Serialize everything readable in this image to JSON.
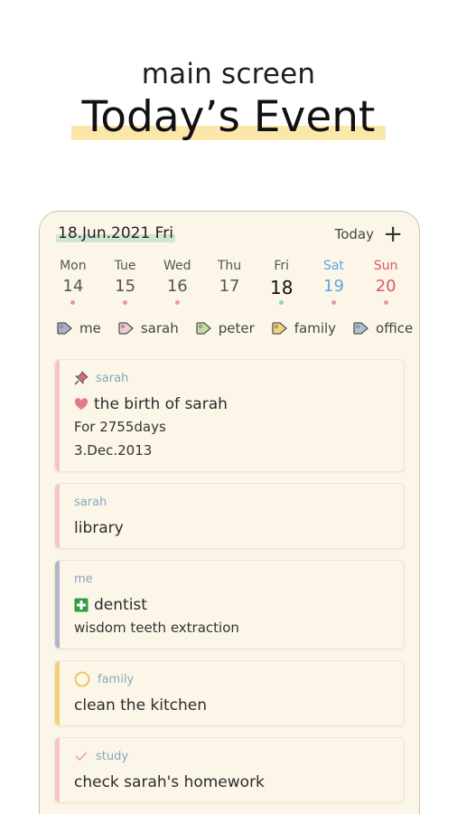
{
  "promo": {
    "subtitle": "main screen",
    "title": "Today’s Event"
  },
  "colors": {
    "highlight": "#fbe7a9",
    "date_highlight": "#cfe6d3",
    "saturday": "#5aa7dc",
    "sunday": "#dd5767",
    "background": "#fcf6e9"
  },
  "header": {
    "date": "18.Jun.2021 Fri",
    "today_label": "Today",
    "add_icon": "plus-icon"
  },
  "week": [
    {
      "name": "Mon",
      "date": "14",
      "dot": "#e89a9a"
    },
    {
      "name": "Tue",
      "date": "15",
      "dot": "#e89a9a"
    },
    {
      "name": "Wed",
      "date": "16",
      "dot": "#e89a9a"
    },
    {
      "name": "Thu",
      "date": "17",
      "dot": ""
    },
    {
      "name": "Fri",
      "date": "18",
      "dot": "#8fd1b9"
    },
    {
      "name": "Sat",
      "date": "19",
      "dot": "#e89a9a"
    },
    {
      "name": "Sun",
      "date": "20",
      "dot": "#e89a9a"
    }
  ],
  "tags": [
    {
      "label": "me",
      "color": "#a9b2c4"
    },
    {
      "label": "sarah",
      "color": "#f1c9cf"
    },
    {
      "label": "peter",
      "color": "#c9d9a6"
    },
    {
      "label": "family",
      "color": "#f3d27a"
    },
    {
      "label": "office",
      "color": "#a9c4d3"
    }
  ],
  "events": [
    {
      "category": "sarah",
      "category_icon": "pin-icon",
      "title": "the birth of sarah",
      "title_icon": "heart-icon",
      "lines": [
        "For 2755days",
        "3.Dec.2013"
      ],
      "bar_color": "#f4c4c9"
    },
    {
      "category": "sarah",
      "category_icon": "",
      "title": "library",
      "title_icon": "",
      "lines": [],
      "bar_color": "#f4c4c9"
    },
    {
      "category": "me",
      "category_icon": "",
      "title": "dentist",
      "title_icon": "medical-cross-icon",
      "lines": [
        "wisdom teeth extraction"
      ],
      "bar_color": "#b2b6c8"
    },
    {
      "category": "family",
      "category_icon": "circle-icon",
      "title": "clean the kitchen",
      "title_icon": "",
      "lines": [],
      "bar_color": "#f3d27a"
    },
    {
      "category": "study",
      "category_icon": "check-icon",
      "title": "check sarah's homework",
      "title_icon": "",
      "lines": [],
      "bar_color": "#f4c4c9"
    }
  ]
}
